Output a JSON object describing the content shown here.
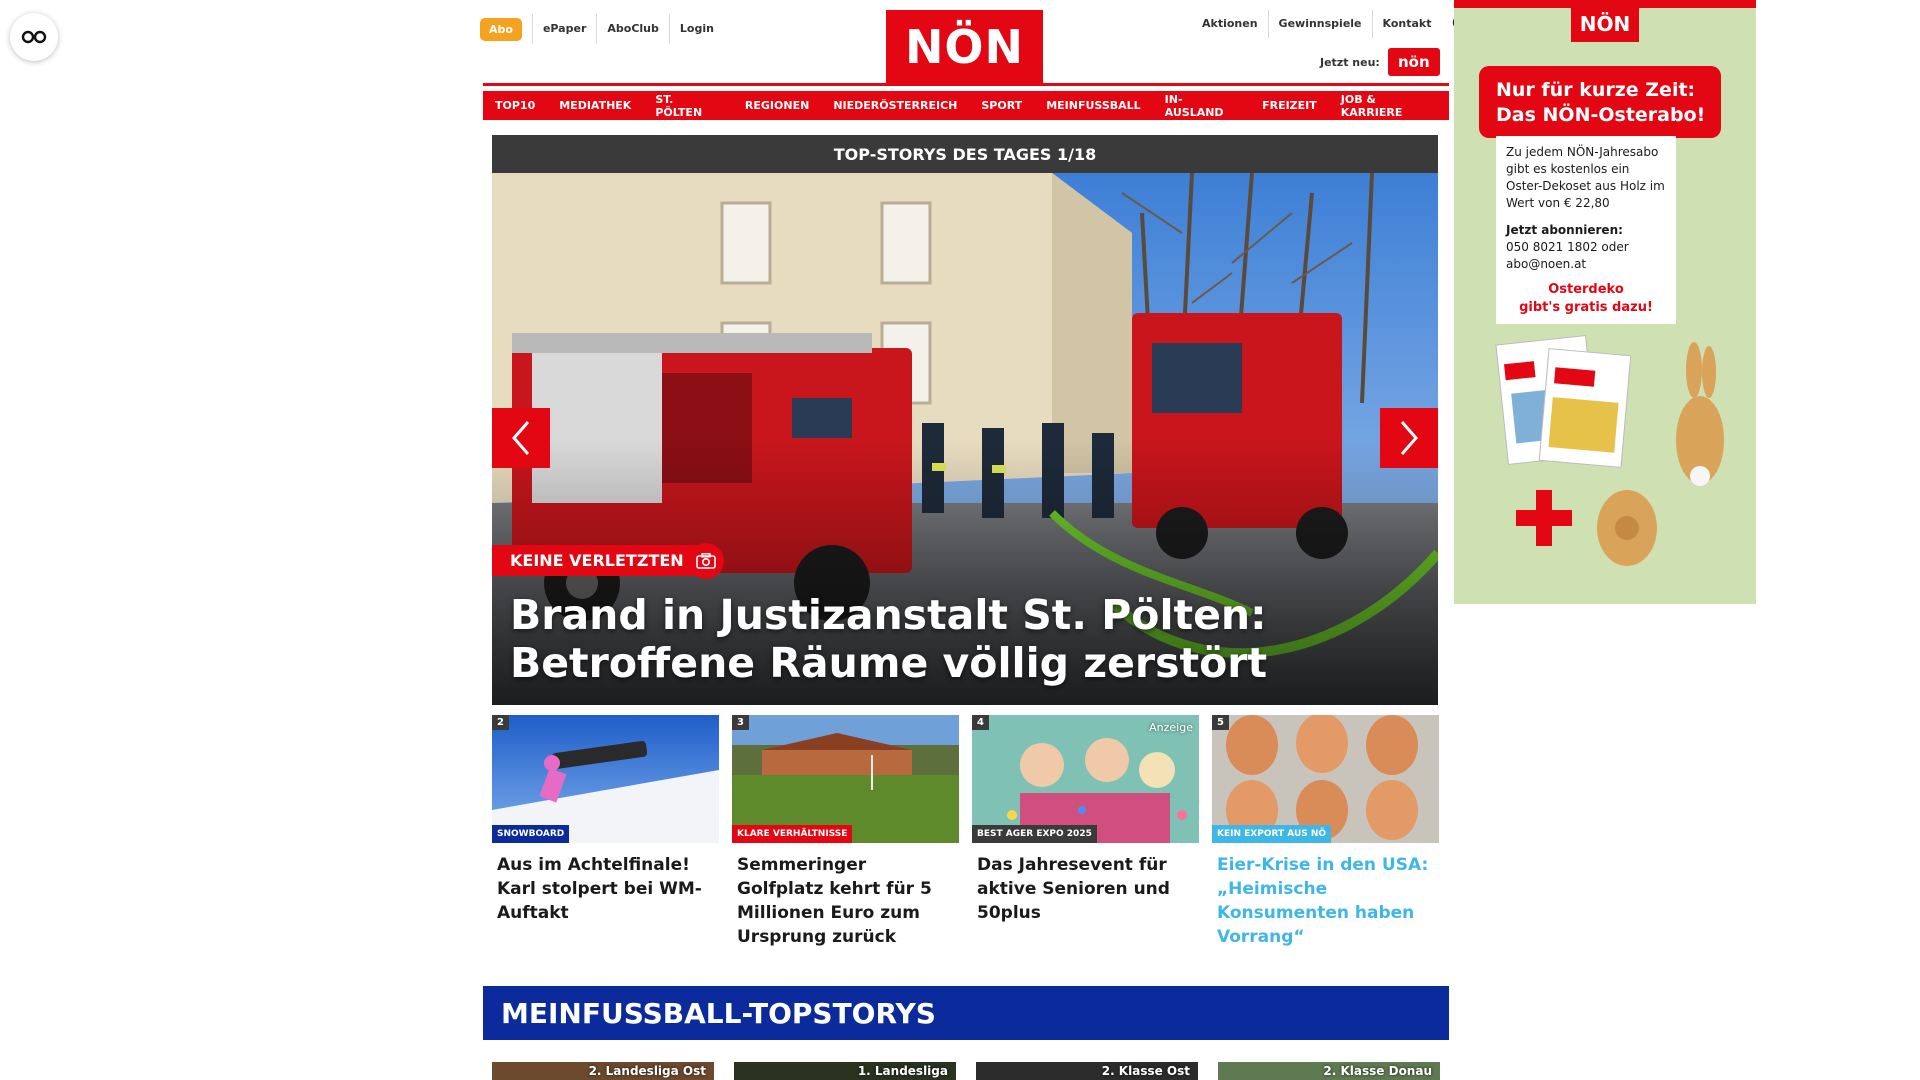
{
  "header": {
    "abo_label": "Abo",
    "left_links": [
      "ePaper",
      "AboClub",
      "Login"
    ],
    "logo_text": "NÖN",
    "right_links": [
      "Aktionen",
      "Gewinnspiele",
      "Kontakt"
    ],
    "jetzt_label": "Jetzt neu:",
    "mini_logo_text": "nön"
  },
  "nav": {
    "items": [
      "TOP10",
      "MEDIATHEK",
      "ST. PÖLTEN",
      "REGIONEN",
      "NIEDERÖSTERREICH",
      "SPORT",
      "MEINFUSSBALL",
      "IN-AUSLAND",
      "FREIZEIT",
      "JOB & KARRIERE"
    ]
  },
  "hero": {
    "bar_title": "TOP-STORYS DES TAGES 1/18",
    "tag": "KEINE VERLETZTEN",
    "title": "Brand in Justizanstalt St. Pölten: Betroffene Räume völlig zerstört"
  },
  "stories": [
    {
      "num": "2",
      "tag": "SNOWBOARD",
      "tag_color": "#0b2a9c",
      "title": "Aus im Achtelfinale! Karl stolpert bei WM-Auftakt",
      "title_color": "#1a1a1a",
      "ad_label": ""
    },
    {
      "num": "3",
      "tag": "KLARE VERHÄLTNISSE",
      "tag_color": "#e30613",
      "title": "Semmeringer Golfplatz kehrt für 5 Millionen Euro zum Ursprung zurück",
      "title_color": "#1a1a1a",
      "ad_label": ""
    },
    {
      "num": "4",
      "tag": "BEST AGER EXPO 2025",
      "tag_color": "#3a3a3a",
      "title": "Das Jahresevent für aktive Senioren und 50plus",
      "title_color": "#1a1a1a",
      "ad_label": "Anzeige"
    },
    {
      "num": "5",
      "tag": "KEIN EXPORT AUS NÖ",
      "tag_color": "#3fb7e6",
      "title": "Eier-Krise in den USA: „Heimische Konsumenten haben Vorrang“",
      "title_color": "#3fb7e6",
      "ad_label": ""
    }
  ],
  "section": {
    "title": "MEINFUSSBALL-TOPSTORYS",
    "thumb_labels": [
      "2. Landesliga Ost",
      "1. Landesliga",
      "2. Klasse Ost",
      "2. Klasse Donau"
    ]
  },
  "ad": {
    "logo": "NÖN",
    "headline_1": "Nur für kurze Zeit:",
    "headline_2": "Das NÖN-Osterabo!",
    "body_1": "Zu jedem NÖN-Jahresabo gibt es kostenlos ein Oster-Dekoset aus Holz im Wert von € 22,80",
    "cta_label": "Jetzt abonnieren:",
    "cta_contact": "050 8021 1802 oder abo@noen.at",
    "red_1": "Osterdeko",
    "red_2": "gibt's gratis dazu!"
  },
  "colors": {
    "brand_red": "#e30613",
    "abo_orange": "#f4a21f",
    "section_blue": "#0b2a9c",
    "highlight_blue": "#3fb7e6"
  }
}
